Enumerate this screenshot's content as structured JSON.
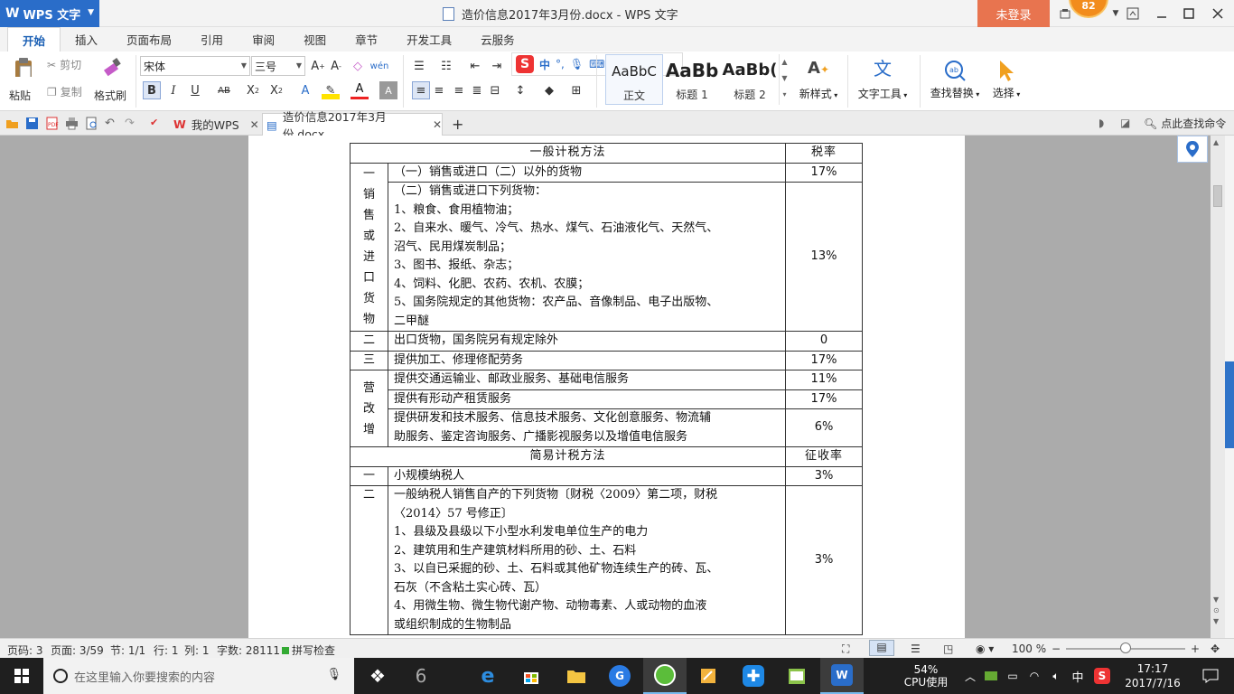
{
  "app": {
    "name": "WPS 文字",
    "logo": "W",
    "window_title": "造价信息2017年3月份.docx - WPS 文字",
    "login": "未登录",
    "badge": "82"
  },
  "ribbon_tabs": [
    "开始",
    "插入",
    "页面布局",
    "引用",
    "审阅",
    "视图",
    "章节",
    "开发工具",
    "云服务"
  ],
  "ribbon": {
    "paste": "粘贴",
    "cut": "剪切",
    "copy": "复制",
    "format_painter": "格式刷",
    "font_name": "宋体",
    "font_size": "三号",
    "styles": [
      {
        "preview": "AaBbC",
        "label": "正文"
      },
      {
        "preview": "AaBb",
        "label": "标题 1"
      },
      {
        "preview": "AaBb(",
        "label": "标题 2"
      }
    ],
    "new_style": "新样式",
    "text_tools": "文字工具",
    "find_replace": "查找替换",
    "select": "选择"
  },
  "doc_tabs": {
    "my_wps": "我的WPS",
    "current_doc": "造价信息2017年3月份.docx",
    "search_cmd": "点此查找命令"
  },
  "table": {
    "header_general": "一般计税方法",
    "header_rate": "税率",
    "rows": [
      {
        "num": "一",
        "text": "（一）销售或进口（二）以外的货物",
        "rate": "17%"
      },
      {
        "lines": [
          "（二）销售或进口下列货物：",
          "1、粮食、食用植物油；",
          "2、自来水、暖气、冷气、热水、煤气、石油液化气、天然气、",
          "沼气、民用煤炭制品；",
          "3、图书、报纸、杂志；",
          "4、饲料、化肥、农药、农机、农膜；",
          "5、国务院规定的其他货物：农产品、音像制品、电子出版物、",
          "二甲醚"
        ],
        "rate": "13%"
      },
      {
        "num": "二",
        "text": "出口货物，国务院另有规定除外",
        "rate": "0"
      },
      {
        "num": "三",
        "text": "提供加工、修理修配劳务",
        "rate": "17%"
      },
      {
        "text": "提供交通运输业、邮政业服务、基础电信服务",
        "rate": "11%"
      },
      {
        "text": "提供有形动产租赁服务",
        "rate": "17%"
      },
      {
        "lines": [
          "提供研发和技术服务、信息技术服务、文化创意服务、物流辅",
          "助服务、鉴定咨询服务、广播影视服务以及增值电信服务"
        ],
        "rate": "6%"
      }
    ],
    "cat1_vertical": "销售或进口货物",
    "cat1_num": "一",
    "cat_yinggaizeng": "营改增",
    "header_simple": "简易计税方法",
    "header_levy": "征收率",
    "simple_rows": [
      {
        "num": "一",
        "text": "小规模纳税人",
        "rate": "3%"
      },
      {
        "num": "二",
        "lines": [
          "一般纳税人销售自产的下列货物〔财税〈2009〉第二项，财税",
          "〈2014〉57 号修正〕",
          "1、县级及县级以下小型水利发电单位生产的电力",
          "2、建筑用和生产建筑材料所用的砂、土、石料",
          "3、以自已采掘的砂、土、石料或其他矿物连续生产的砖、瓦、",
          "石灰（不含粘土实心砖、瓦）",
          "4、用微生物、微生物代谢产物、动物毒素、人或动物的血液",
          "或组织制成的生物制品"
        ],
        "rate": "3%"
      }
    ]
  },
  "status": {
    "page_code": "页码: 3",
    "page": "页面: 3/59",
    "section": "节: 1/1",
    "row": "行: 1",
    "col": "列: 1",
    "words": "字数: 28111",
    "spellcheck": "拼写检查",
    "zoom": "100 %",
    "zoom_level": 0.5
  },
  "taskbar": {
    "search_placeholder": "在这里输入你要搜索的内容",
    "cpu_percent": "54%",
    "cpu_label": "CPU使用",
    "ime": "中",
    "time": "17:17",
    "date": "2017/7/16"
  },
  "colors": {
    "accent": "#2a6dc9",
    "login": "#e8744f",
    "badge": "#f28c1c"
  }
}
